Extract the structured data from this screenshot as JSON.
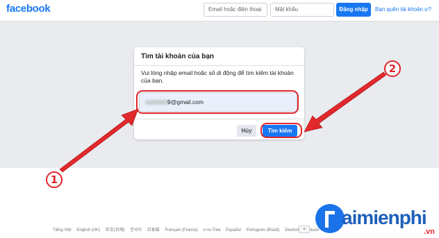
{
  "header": {
    "logo": "facebook",
    "email_placeholder": "Email hoặc điện thoại",
    "password_placeholder": "Mật khẩu",
    "login_label": "Đăng nhập",
    "forgot_label": "Bạn quên tài khoản ư?"
  },
  "card": {
    "title": "Tìm tài khoản của bạn",
    "description": "Vui lòng nhập email hoặc số di động để tìm kiếm tài khoản của bạn.",
    "email_value": "9@gmail.com",
    "cancel_label": "Hủy",
    "search_label": "Tìm kiếm"
  },
  "annotations": {
    "badge1": "1",
    "badge2": "2",
    "color": "#e0252a"
  },
  "footer": {
    "languages": [
      "Tiếng Việt",
      "English (UK)",
      "中文(台灣)",
      "한국어",
      "日本語",
      "Français (France)",
      "ภาษาไทย",
      "Español",
      "Português (Brasil)",
      "Deutsch",
      "Italiano"
    ],
    "plus": "+"
  },
  "watermark": {
    "text": "aimienphi",
    "suffix": ".vn"
  }
}
